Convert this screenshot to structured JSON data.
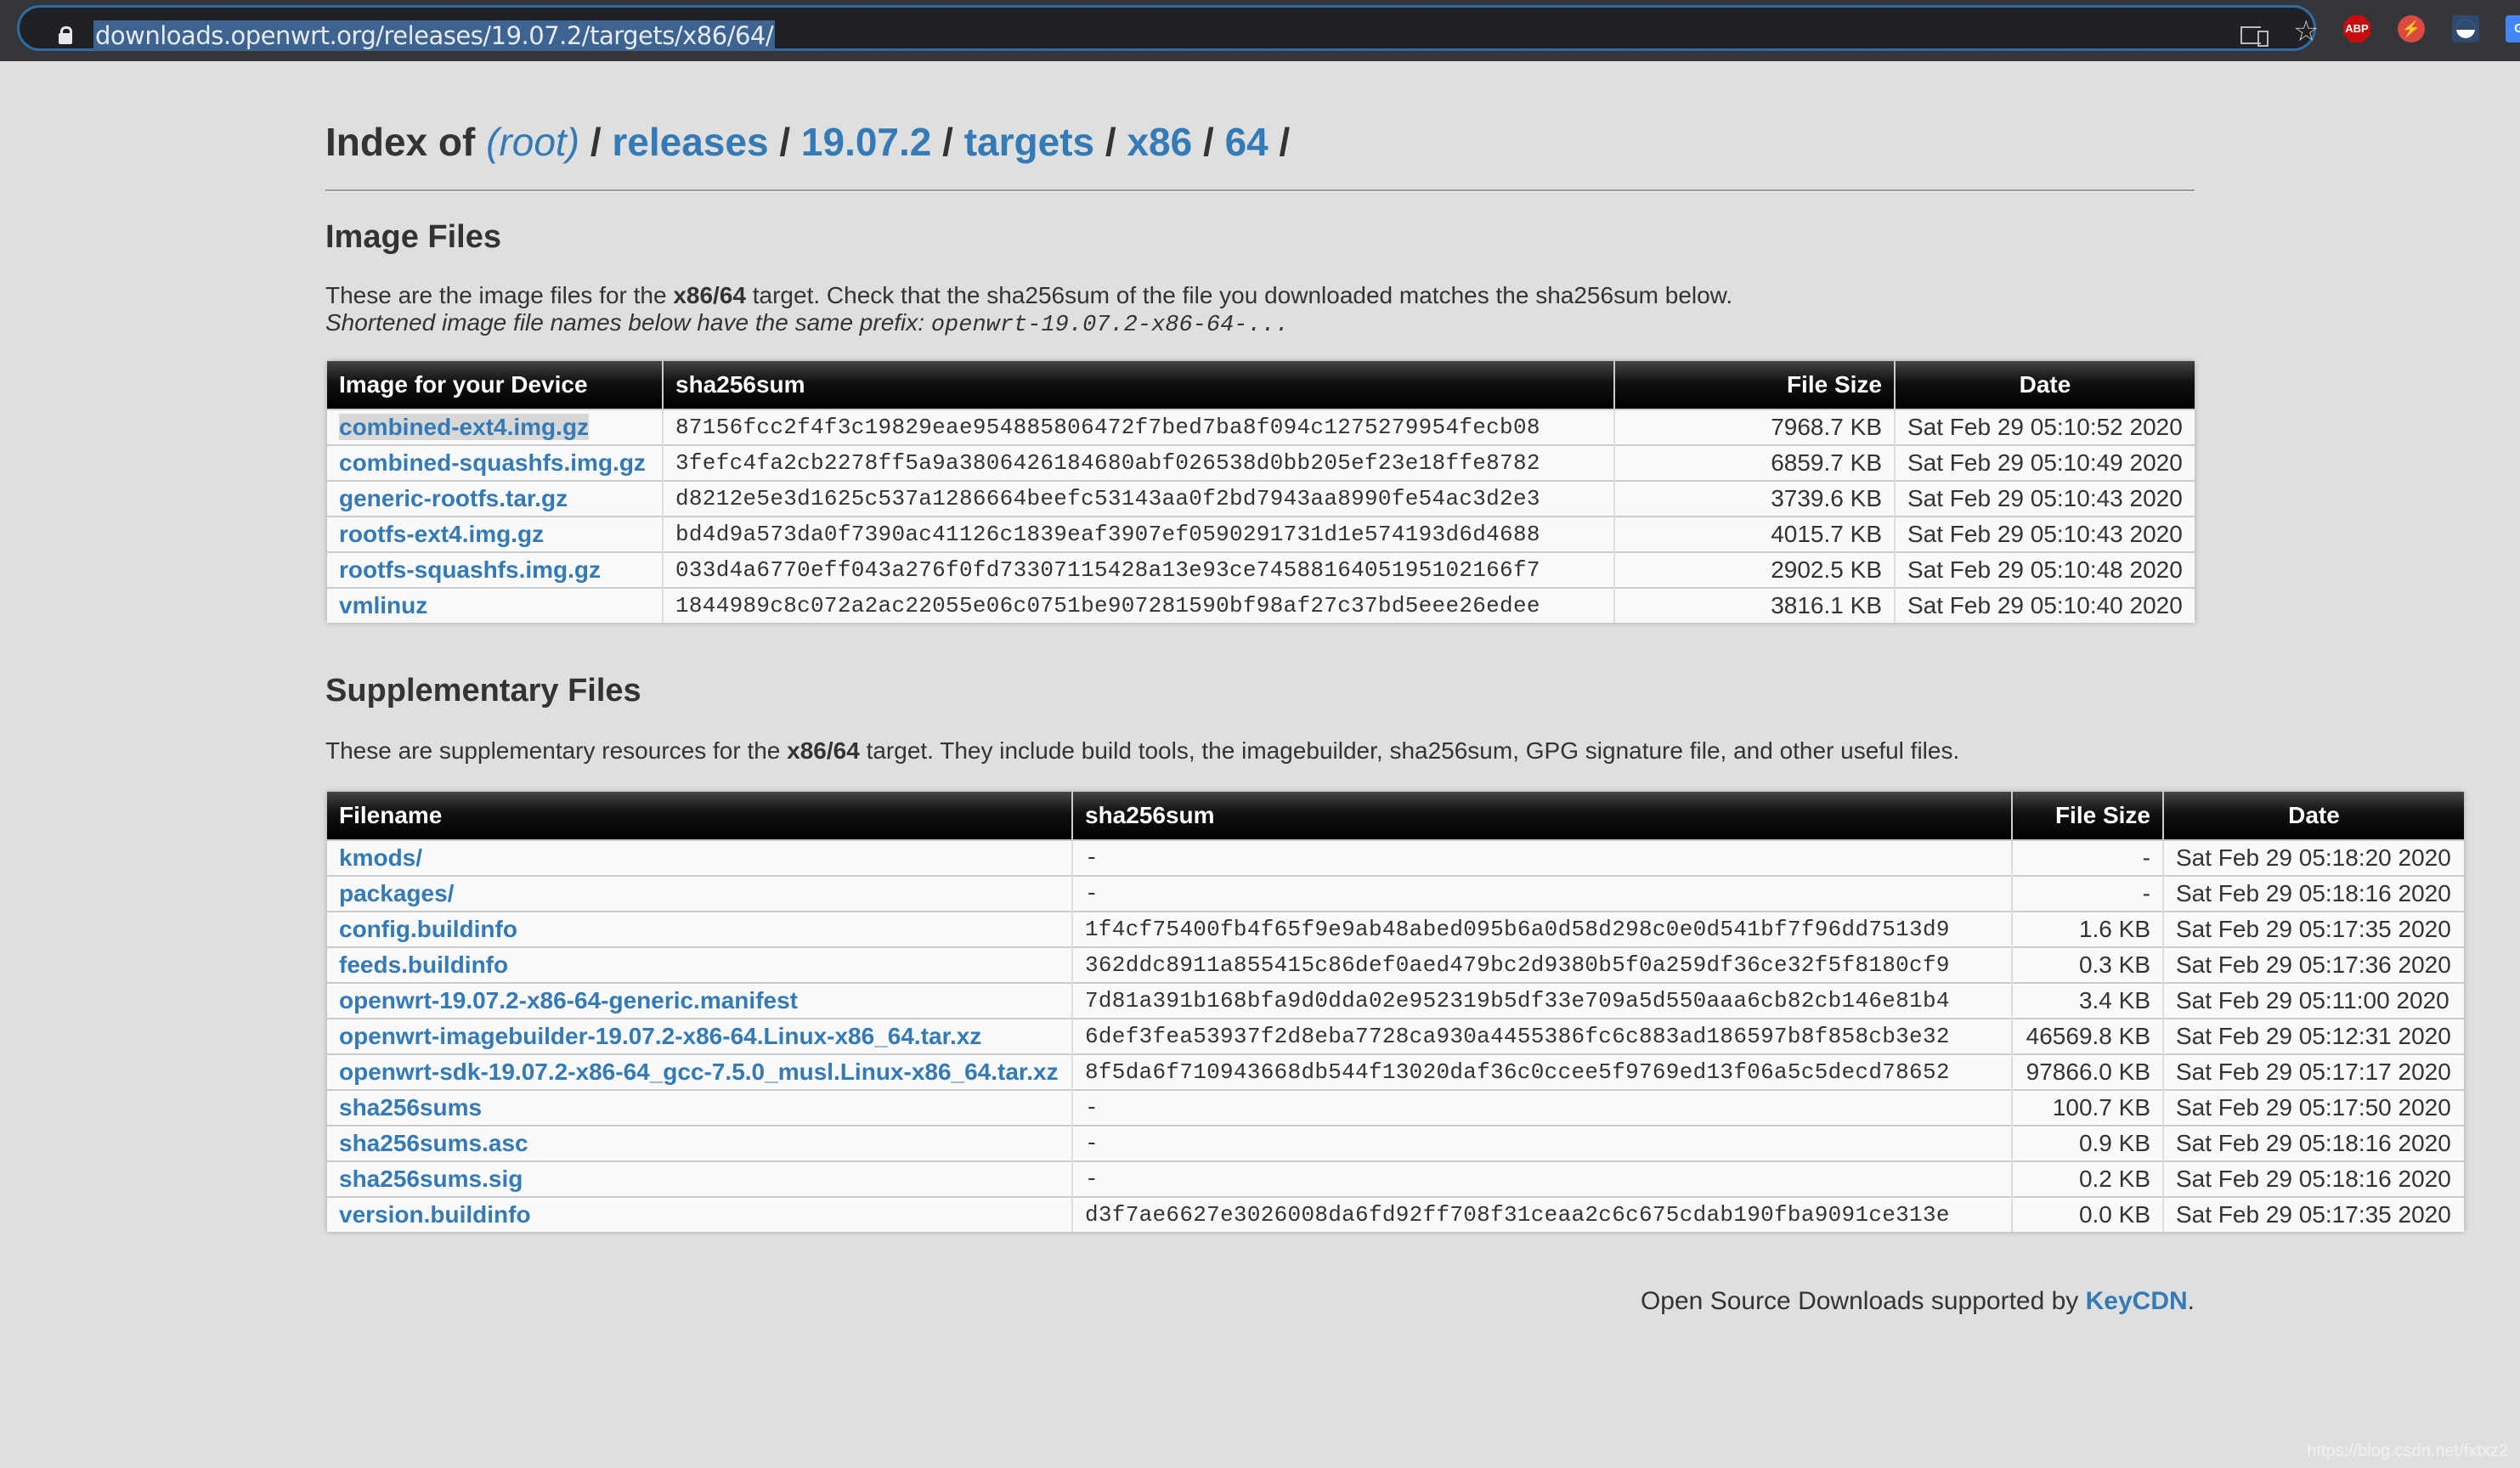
{
  "browser": {
    "url": "downloads.openwrt.org/releases/19.07.2/targets/x86/64/",
    "icons": [
      "lock-icon",
      "cast-icon",
      "star-icon",
      "adblock-plus-icon",
      "plug-extension-icon",
      "moon-extension-icon",
      "google-extension-icon"
    ],
    "abp_label": "ABP",
    "g_label": "G"
  },
  "header": {
    "prefix": "Index of",
    "breadcrumb": [
      {
        "label": "(root)"
      },
      {
        "label": "releases"
      },
      {
        "label": "19.07.2"
      },
      {
        "label": "targets"
      },
      {
        "label": "x86"
      },
      {
        "label": "64"
      }
    ],
    "separator": "/"
  },
  "image_files": {
    "heading": "Image Files",
    "desc_part1": "These are the image files for the ",
    "desc_target": "x86/64",
    "desc_part2": " target. Check that the sha256sum of the file you downloaded matches the sha256sum below.",
    "note_text": "Shortened image file names below have the same prefix: ",
    "note_prefix": "openwrt-19.07.2-x86-64-...",
    "columns": [
      "Image for your Device",
      "sha256sum",
      "File Size",
      "Date"
    ],
    "rows": [
      {
        "name": "combined-ext4.img.gz",
        "sha256": "87156fcc2f4f3c19829eae954885806472f7bed7ba8f094c1275279954fecb08",
        "size": "7968.7 KB",
        "date": "Sat Feb 29 05:10:52 2020"
      },
      {
        "name": "combined-squashfs.img.gz",
        "sha256": "3fefc4fa2cb2278ff5a9a3806426184680abf026538d0bb205ef23e18ffe8782",
        "size": "6859.7 KB",
        "date": "Sat Feb 29 05:10:49 2020"
      },
      {
        "name": "generic-rootfs.tar.gz",
        "sha256": "d8212e5e3d1625c537a1286664beefc53143aa0f2bd7943aa8990fe54ac3d2e3",
        "size": "3739.6 KB",
        "date": "Sat Feb 29 05:10:43 2020"
      },
      {
        "name": "rootfs-ext4.img.gz",
        "sha256": "bd4d9a573da0f7390ac41126c1839eaf3907ef0590291731d1e574193d6d4688",
        "size": "4015.7 KB",
        "date": "Sat Feb 29 05:10:43 2020"
      },
      {
        "name": "rootfs-squashfs.img.gz",
        "sha256": "033d4a6770eff043a276f0fd73307115428a13e93ce7458816405195102166f7",
        "size": "2902.5 KB",
        "date": "Sat Feb 29 05:10:48 2020"
      },
      {
        "name": "vmlinuz",
        "sha256": "1844989c8c072a2ac22055e06c0751be907281590bf98af27c37bd5eee26edee",
        "size": "3816.1 KB",
        "date": "Sat Feb 29 05:10:40 2020"
      }
    ]
  },
  "supplementary_files": {
    "heading": "Supplementary Files",
    "desc_part1": "These are supplementary resources for the ",
    "desc_target": "x86/64",
    "desc_part2": " target. They include build tools, the imagebuilder, sha256sum, GPG signature file, and other useful files.",
    "columns": [
      "Filename",
      "sha256sum",
      "File Size",
      "Date"
    ],
    "rows": [
      {
        "name": "kmods/",
        "sha256": "-",
        "size": "-",
        "date": "Sat Feb 29 05:18:20 2020"
      },
      {
        "name": "packages/",
        "sha256": "-",
        "size": "-",
        "date": "Sat Feb 29 05:18:16 2020"
      },
      {
        "name": "config.buildinfo",
        "sha256": "1f4cf75400fb4f65f9e9ab48abed095b6a0d58d298c0e0d541bf7f96dd7513d9",
        "size": "1.6 KB",
        "date": "Sat Feb 29 05:17:35 2020"
      },
      {
        "name": "feeds.buildinfo",
        "sha256": "362ddc8911a855415c86def0aed479bc2d9380b5f0a259df36ce32f5f8180cf9",
        "size": "0.3 KB",
        "date": "Sat Feb 29 05:17:36 2020"
      },
      {
        "name": "openwrt-19.07.2-x86-64-generic.manifest",
        "sha256": "7d81a391b168bfa9d0dda02e952319b5df33e709a5d550aaa6cb82cb146e81b4",
        "size": "3.4 KB",
        "date": "Sat Feb 29 05:11:00 2020"
      },
      {
        "name": "openwrt-imagebuilder-19.07.2-x86-64.Linux-x86_64.tar.xz",
        "sha256": "6def3fea53937f2d8eba7728ca930a4455386fc6c883ad186597b8f858cb3e32",
        "size": "46569.8 KB",
        "date": "Sat Feb 29 05:12:31 2020"
      },
      {
        "name": "openwrt-sdk-19.07.2-x86-64_gcc-7.5.0_musl.Linux-x86_64.tar.xz",
        "sha256": "8f5da6f710943668db544f13020daf36c0ccee5f9769ed13f06a5c5decd78652",
        "size": "97866.0 KB",
        "date": "Sat Feb 29 05:17:17 2020"
      },
      {
        "name": "sha256sums",
        "sha256": "-",
        "size": "100.7 KB",
        "date": "Sat Feb 29 05:17:50 2020"
      },
      {
        "name": "sha256sums.asc",
        "sha256": "-",
        "size": "0.9 KB",
        "date": "Sat Feb 29 05:18:16 2020"
      },
      {
        "name": "sha256sums.sig",
        "sha256": "-",
        "size": "0.2 KB",
        "date": "Sat Feb 29 05:18:16 2020"
      },
      {
        "name": "version.buildinfo",
        "sha256": "d3f7ae6627e3026008da6fd92ff708f31ceaa2c6c675cdab190fba9091ce313e",
        "size": "0.0 KB",
        "date": "Sat Feb 29 05:17:35 2020"
      }
    ]
  },
  "footer": {
    "text": "Open Source Downloads supported by ",
    "link": "KeyCDN",
    "suffix": "."
  },
  "watermark": "https://blog.csdn.net/fxtxz2"
}
